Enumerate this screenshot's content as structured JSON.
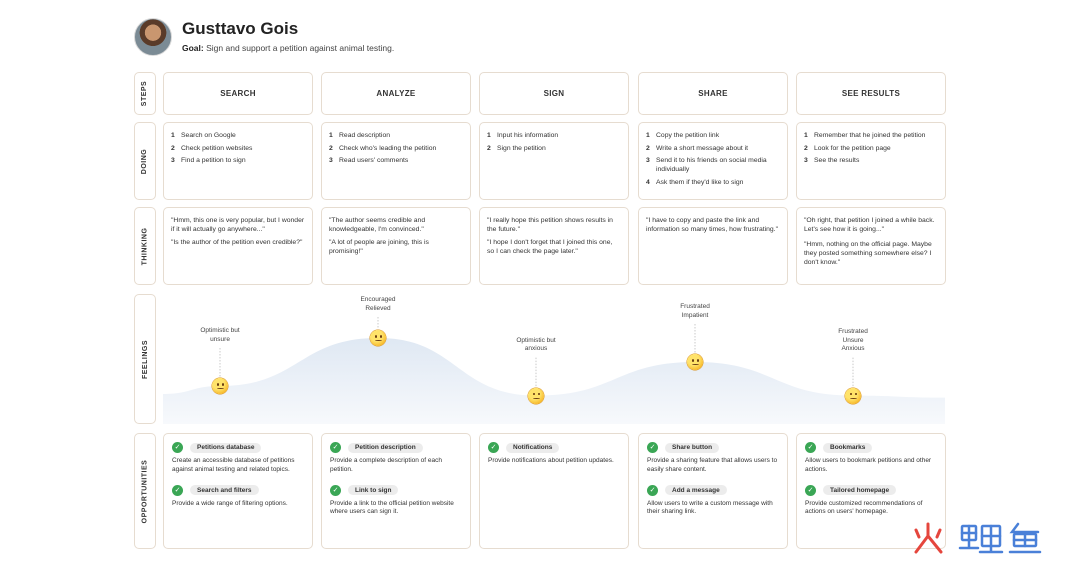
{
  "persona": {
    "name": "Gusttavo Gois",
    "goal_label": "Goal:",
    "goal_text": "Sign and support a petition against animal testing."
  },
  "row_labels": {
    "steps": "STEPS",
    "doing": "DOING",
    "thinking": "THINKING",
    "feelings": "FEELINGS",
    "opportunities": "OPPORTUNITIES"
  },
  "steps": [
    {
      "title": "SEARCH",
      "doing": [
        {
          "n": "1",
          "text": "Search on Google"
        },
        {
          "n": "2",
          "text": "Check petition websites"
        },
        {
          "n": "3",
          "text": "Find a petition to sign"
        }
      ],
      "thinking": [
        "\"Hmm, this one is very popular, but I wonder if it will actually go anywhere...\"",
        "\"Is the author of the petition even credible?\""
      ],
      "feeling": {
        "lines": [
          "Optimistic but",
          "unsure"
        ],
        "emoji": "slightly-frowning-face-icon",
        "level": 0.3
      },
      "opportunities": [
        {
          "tag": "Petitions database",
          "desc": "Create an accessible database of petitions against animal testing and related topics."
        },
        {
          "tag": "Search and filters",
          "desc": "Provide a wide range of filtering options."
        }
      ]
    },
    {
      "title": "ANALYZE",
      "doing": [
        {
          "n": "1",
          "text": "Read description"
        },
        {
          "n": "2",
          "text": "Check who's leading the petition"
        },
        {
          "n": "3",
          "text": "Read users' comments"
        }
      ],
      "thinking": [
        "\"The author seems credible and knowledgeable, I'm convinced.\"",
        "\"A lot of people are joining, this is promising!\""
      ],
      "feeling": {
        "lines": [
          "Encouraged",
          "Relieved"
        ],
        "emoji": "relieved-face-icon",
        "level": 0.7
      },
      "opportunities": [
        {
          "tag": "Petition description",
          "desc": "Provide a complete description of each petition."
        },
        {
          "tag": "Link to sign",
          "desc": "Provide a link to the official petition website where users can sign it."
        }
      ]
    },
    {
      "title": "SIGN",
      "doing": [
        {
          "n": "1",
          "text": "Input his information"
        },
        {
          "n": "2",
          "text": "Sign the petition"
        }
      ],
      "thinking": [
        "\"I really hope this petition shows results in the future.\"",
        "\"I hope I don't forget that I joined this one, so I can check the page later.\""
      ],
      "feeling": {
        "lines": [
          "Optimistic but",
          "anxious"
        ],
        "emoji": "worried-face-icon",
        "level": 0.22
      },
      "opportunities": [
        {
          "tag": "Notifications",
          "desc": "Provide notifications about petition updates."
        }
      ]
    },
    {
      "title": "SHARE",
      "doing": [
        {
          "n": "1",
          "text": "Copy the petition link"
        },
        {
          "n": "2",
          "text": "Write a short message about it"
        },
        {
          "n": "3",
          "text": "Send it to his friends on social media individually"
        },
        {
          "n": "4",
          "text": "Ask them if they'd like to sign"
        }
      ],
      "thinking": [
        "\"I have to copy and paste the link and information so many times, how frustrating.\""
      ],
      "feeling": {
        "lines": [
          "Frustrated",
          "Impatient"
        ],
        "emoji": "confounded-face-icon",
        "level": 0.5
      },
      "opportunities": [
        {
          "tag": "Share button",
          "desc": "Provide a sharing feature that allows users to easily share content."
        },
        {
          "tag": "Add a message",
          "desc": "Allow users to write a custom message with their sharing link."
        }
      ]
    },
    {
      "title": "SEE RESULTS",
      "doing": [
        {
          "n": "1",
          "text": "Remember that he joined the petition"
        },
        {
          "n": "2",
          "text": "Look for the petition page"
        },
        {
          "n": "3",
          "text": "See the results"
        }
      ],
      "thinking": [
        "\"Oh right, that petition I joined a while back. Let's see how it is going...\"",
        "\"Hmm, nothing on the official page. Maybe they posted something somewhere else? I don't know.\""
      ],
      "feeling": {
        "lines": [
          "Frustrated",
          "Unsure",
          "Anxious"
        ],
        "emoji": "thinking-face-icon",
        "level": 0.22
      },
      "opportunities": [
        {
          "tag": "Bookmarks",
          "desc": "Allow users to bookmark petitions and other actions."
        },
        {
          "tag": "Tailored homepage",
          "desc": "Provide customized recommendations of actions on users' homepage."
        }
      ]
    }
  ],
  "colors": {
    "card_border": "#e6dcd0",
    "wave_fill_top": "#e3ebf5",
    "check_icon": "#3aa655",
    "watermark": "#e5463d"
  },
  "watermark": {
    "text": "火鲤鱼",
    "icon": "watermark-logo-icon"
  }
}
